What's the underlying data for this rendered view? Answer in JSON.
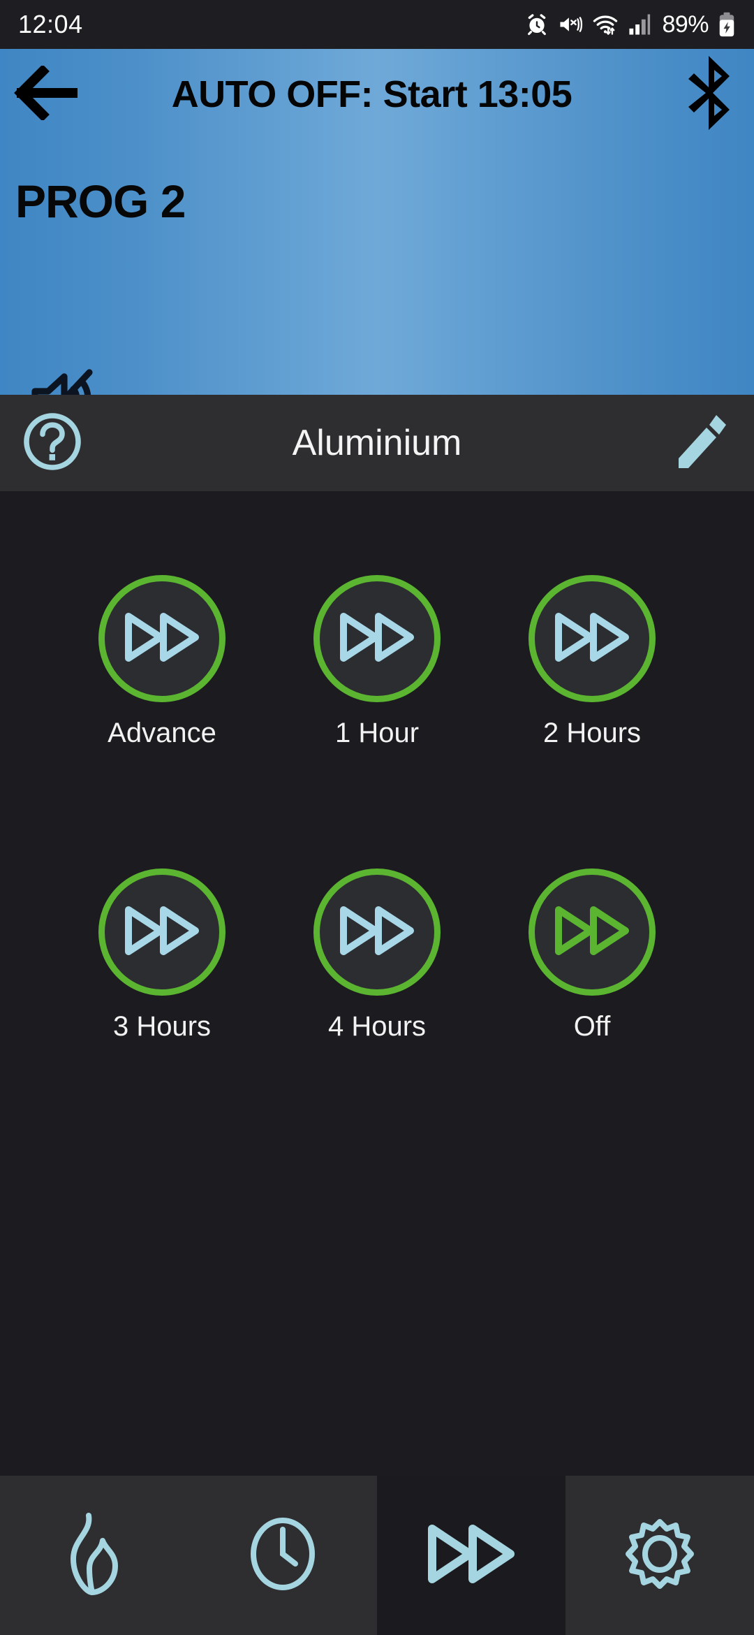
{
  "status_bar": {
    "time": "12:04",
    "battery_percent": "89%",
    "icons": [
      "alarm-icon",
      "mute-vibrate-icon",
      "wifi-icon",
      "signal-icon",
      "battery-charging-icon"
    ]
  },
  "header": {
    "back_icon": "back-arrow-icon",
    "title": "AUTO OFF: Start 13:05",
    "bluetooth_icon": "bluetooth-icon",
    "program_label": "PROG 2",
    "mute_icon": "speaker-mute-icon",
    "gradient_start": "#3f86c4",
    "gradient_mid": "#6fa9d8",
    "gradient_end": "#3f86c4"
  },
  "toolbar": {
    "help_icon": "help-circle-icon",
    "device_name": "Aluminium",
    "edit_icon": "pencil-icon",
    "accent_color": "#a5d5e0"
  },
  "main": {
    "ring_color": "#5cb531",
    "icon_color": "#a8d8e8",
    "active_icon_color": "#5cb531",
    "options": [
      {
        "label": "Advance",
        "icon": "fast-forward-icon",
        "selected": false
      },
      {
        "label": "1 Hour",
        "icon": "fast-forward-icon",
        "selected": false
      },
      {
        "label": "2 Hours",
        "icon": "fast-forward-icon",
        "selected": false
      },
      {
        "label": "3 Hours",
        "icon": "fast-forward-icon",
        "selected": false
      },
      {
        "label": "4 Hours",
        "icon": "fast-forward-icon",
        "selected": false
      },
      {
        "label": "Off",
        "icon": "fast-forward-icon",
        "selected": true
      }
    ]
  },
  "bottom_nav": {
    "tabs": [
      {
        "icon": "flame-icon",
        "active": false
      },
      {
        "icon": "clock-icon",
        "active": false
      },
      {
        "icon": "fast-forward-icon",
        "active": true
      },
      {
        "icon": "gear-icon",
        "active": false
      }
    ]
  }
}
